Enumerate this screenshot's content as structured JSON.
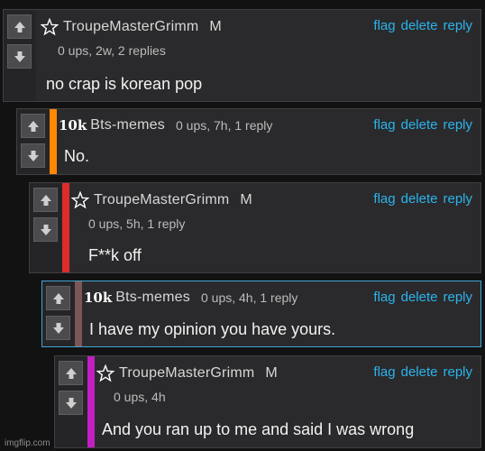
{
  "comments": [
    {
      "username": "TroupeMasterGrimm",
      "gender": "M",
      "meta": "0 ups, 2w, 2 replies",
      "text": "no crap is korean pop",
      "badge": "star-icon",
      "bar_color": "",
      "actions": {
        "flag": "flag",
        "delete": "delete",
        "reply": "reply"
      }
    },
    {
      "username": "Bts-memes",
      "level": "10k",
      "meta": "0 ups, 7h, 1 reply",
      "text": "No.",
      "bar_color": "#ff8800",
      "actions": {
        "flag": "flag",
        "delete": "delete",
        "reply": "reply"
      }
    },
    {
      "username": "TroupeMasterGrimm",
      "gender": "M",
      "meta": "0 ups, 5h, 1 reply",
      "text": "F**k off",
      "badge": "star-icon",
      "bar_color": "#e02b2b",
      "actions": {
        "flag": "flag",
        "delete": "delete",
        "reply": "reply"
      }
    },
    {
      "username": "Bts-memes",
      "level": "10k",
      "meta": "0 ups, 4h, 1 reply",
      "text": "I have my opinion you have yours.",
      "bar_color": "#7a5656",
      "highlighted": true,
      "actions": {
        "flag": "flag",
        "delete": "delete",
        "reply": "reply"
      }
    },
    {
      "username": "TroupeMasterGrimm",
      "gender": "M",
      "meta": "0 ups, 4h",
      "text": "And you ran up to me and said I was wrong",
      "badge": "star-icon",
      "bar_color": "#c21fc2",
      "actions": {
        "flag": "flag",
        "delete": "delete",
        "reply": "reply"
      }
    }
  ],
  "watermark": "imgflip.com",
  "colors": {
    "link": "#2ab4ec",
    "highlight_border": "#3fa6d6"
  }
}
